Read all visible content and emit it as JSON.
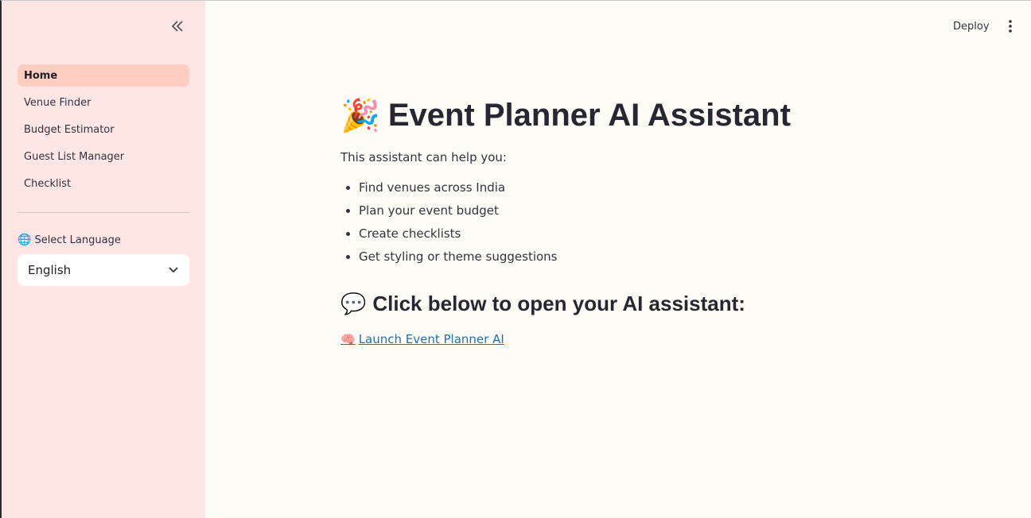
{
  "sidebar": {
    "nav_items": [
      {
        "label": "Home",
        "active": true
      },
      {
        "label": "Venue Finder",
        "active": false
      },
      {
        "label": "Budget Estimator",
        "active": false
      },
      {
        "label": "Guest List Manager",
        "active": false
      },
      {
        "label": "Checklist",
        "active": false
      }
    ],
    "language_label": "Select Language",
    "language_icon": "🌐",
    "language_selected": "English"
  },
  "header": {
    "deploy_label": "Deploy"
  },
  "main": {
    "title_emoji": "🎉",
    "title": "Event Planner AI Assistant",
    "intro": "This assistant can help you:",
    "features": [
      "Find venues across India",
      "Plan your event budget",
      "Create checklists",
      "Get styling or theme suggestions"
    ],
    "subhead_emoji": "💬",
    "subhead": "Click below to open your AI assistant:",
    "launch_emoji": "🧠",
    "launch_label": "Launch Event Planner AI"
  },
  "colors": {
    "sidebar_bg": "#ffe6e4",
    "active_nav_bg": "#ffcdc2",
    "main_bg": "#fffcf7",
    "link": "#1c6fb8"
  }
}
